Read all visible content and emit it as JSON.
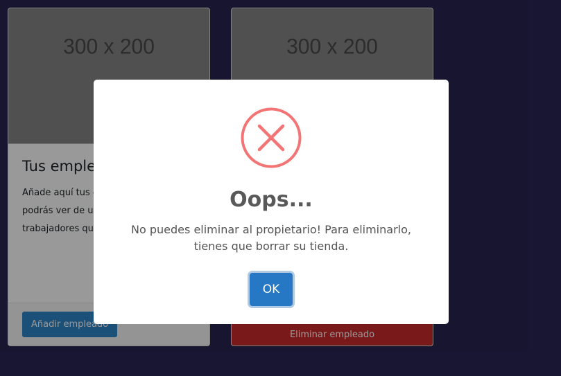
{
  "colors": {
    "page_background": "#282453",
    "primary": "#2d85c8",
    "danger": "#cc2a2a",
    "error_icon": "#f27474",
    "ok_button": "#2778c4"
  },
  "cards": [
    {
      "image_placeholder": "300 x 200",
      "title": "Tus emplea",
      "text_lines": [
        "Añade aquí tus e",
        "podrás ver de u",
        "trabajadores que"
      ],
      "button_label": "Añadir empleado"
    },
    {
      "image_placeholder": "300 x 200",
      "button_label": "Eliminar empleado"
    }
  ],
  "modal": {
    "icon": "error-x-icon",
    "title": "Oops...",
    "message_line1": "No puedes eliminar al propietario! Para eliminarlo,",
    "message_line2": "tienes que borrar su tienda.",
    "confirm_label": "OK"
  }
}
